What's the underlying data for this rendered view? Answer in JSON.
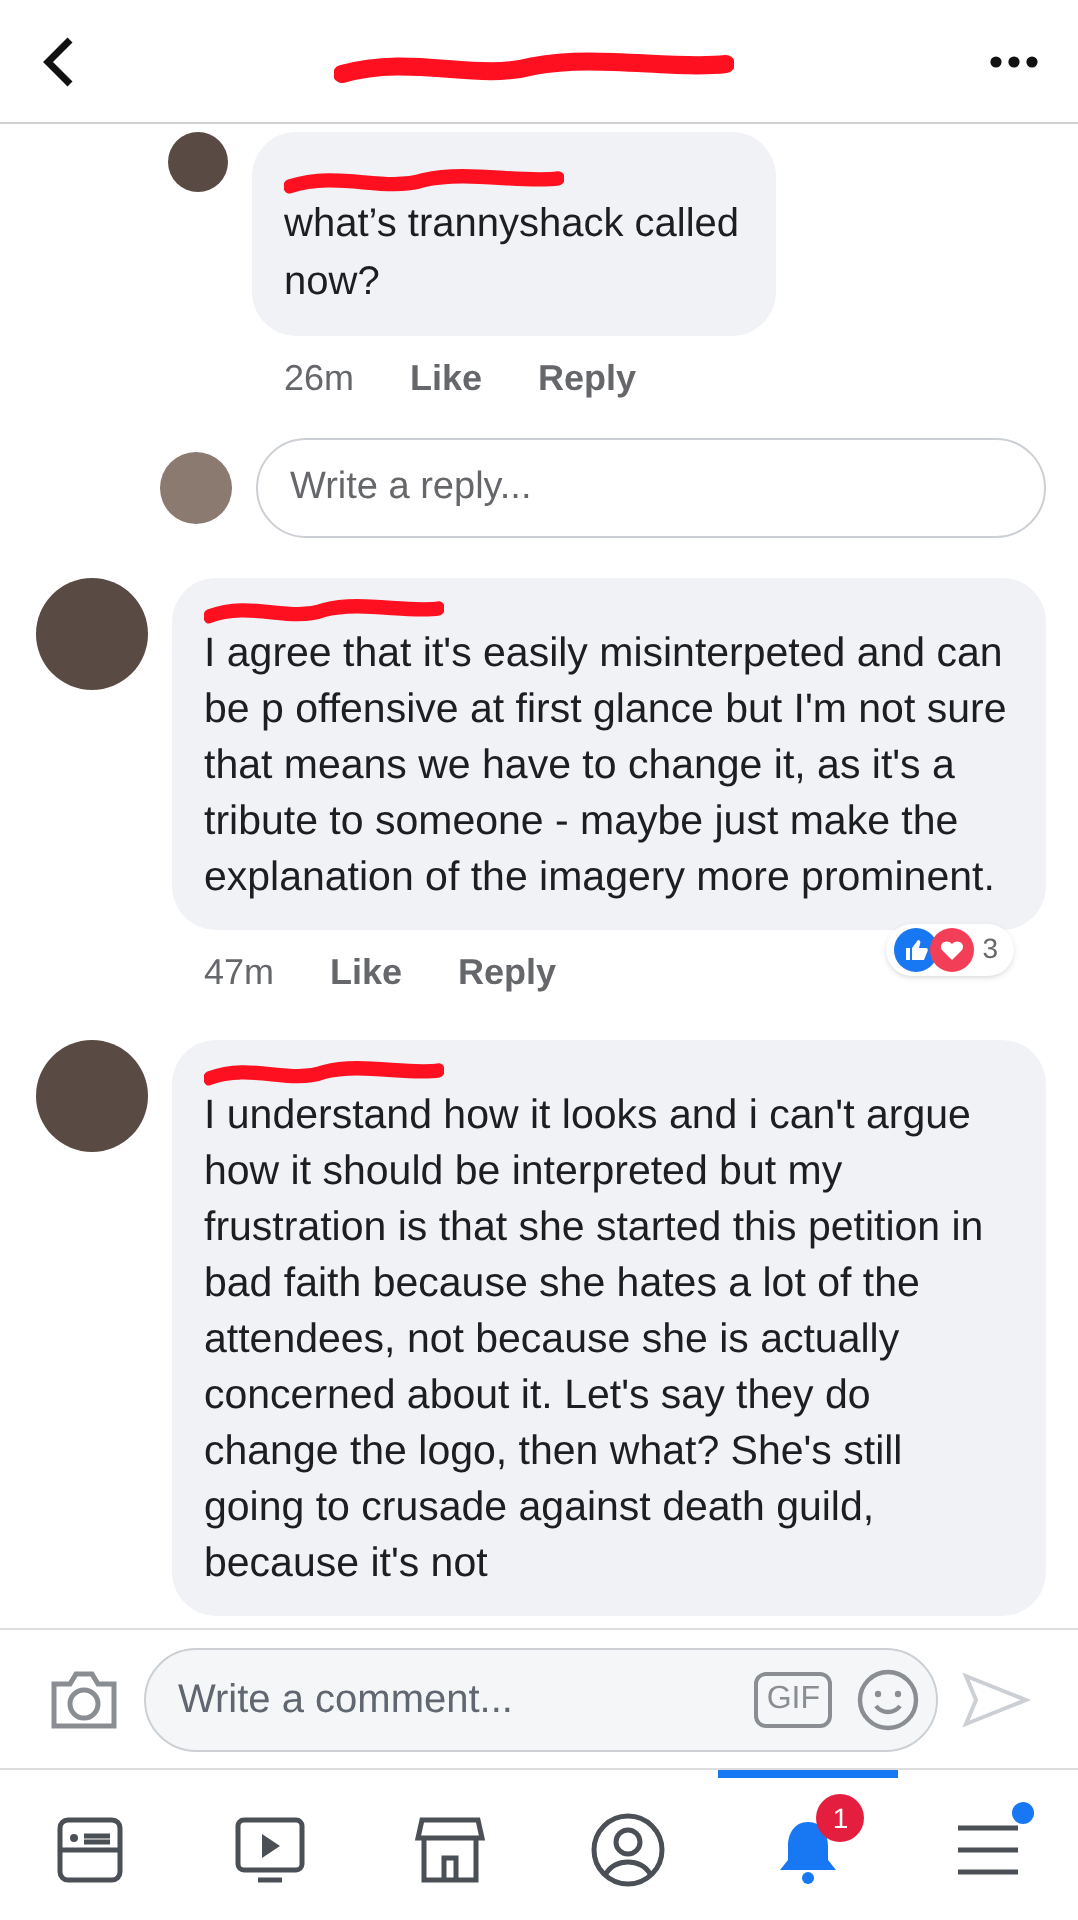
{
  "header": {
    "title_redacted": true
  },
  "comments": [
    {
      "kind": "reply",
      "text": "what’s trannyshack called now?",
      "time": "26m",
      "like": "Like",
      "reply": "Reply"
    },
    {
      "kind": "reply-box",
      "placeholder": "Write a reply..."
    },
    {
      "kind": "comment",
      "text": "I agree that it's easily misinterpeted and can be p offensive at first glance but I'm not sure that means we have to change it, as it's a tribute to someone - maybe just make the explanation of the imagery more prominent.",
      "time": "47m",
      "like": "Like",
      "reply": "Reply",
      "reaction_count": "3"
    },
    {
      "kind": "comment",
      "text": "I understand how it looks and i can't argue how it should be interpreted but my frustration is that she started this petition in bad faith because she hates a lot of the attendees, not because she is actually concerned about it. Let's say they do change the logo, then what? She's still going to crusade against death guild, because it's not"
    }
  ],
  "composer": {
    "placeholder": "Write a comment...",
    "gif": "GIF"
  },
  "nav": [
    {
      "kind": "feed",
      "selected": false
    },
    {
      "kind": "video",
      "selected": false
    },
    {
      "kind": "market",
      "selected": false
    },
    {
      "kind": "profile",
      "selected": false
    },
    {
      "kind": "bell",
      "selected": true,
      "badge": "1"
    },
    {
      "kind": "menu",
      "selected": false,
      "dot": true
    }
  ]
}
